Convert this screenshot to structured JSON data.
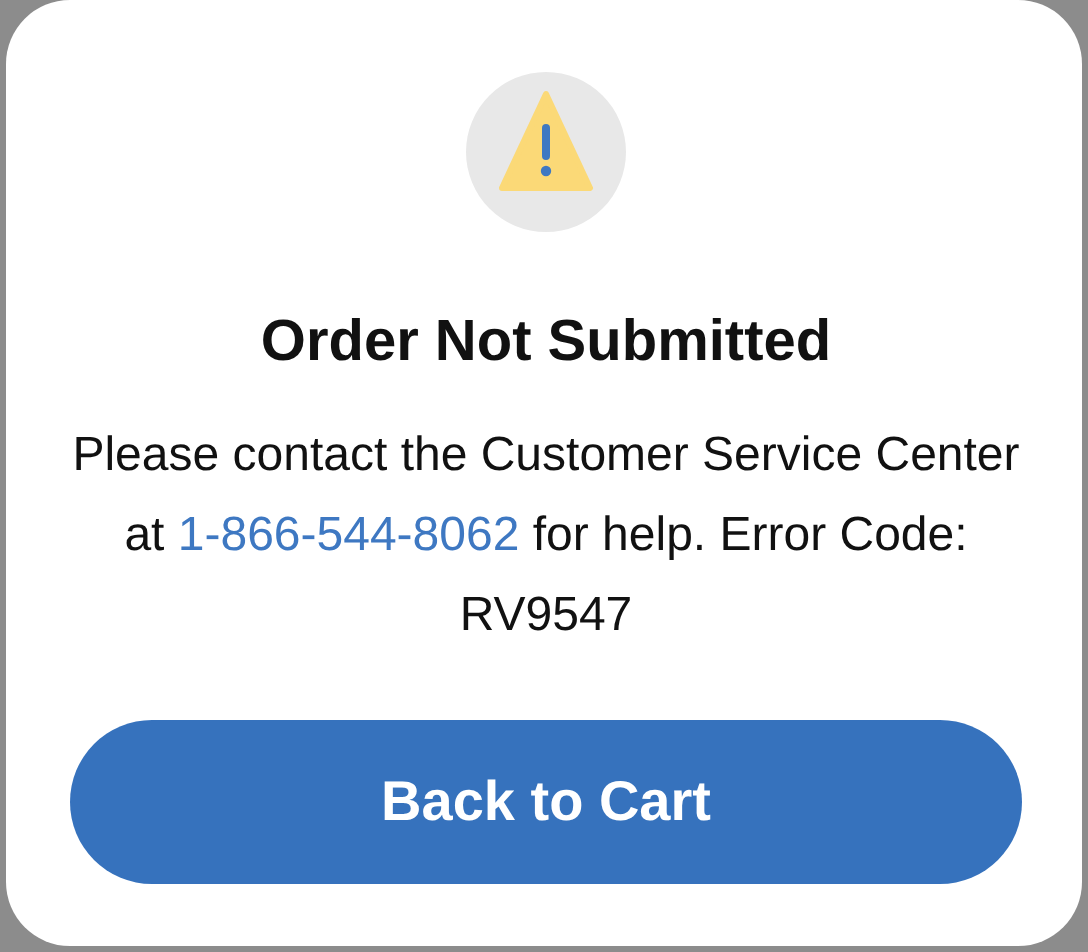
{
  "dialog": {
    "title": "Order Not Submitted",
    "message": {
      "before": "Please contact the Customer Service Center at",
      "phone_link": "1-866-544-8062",
      "after": "for help. Error Code: RV9547"
    },
    "button": "Back to Cart"
  }
}
